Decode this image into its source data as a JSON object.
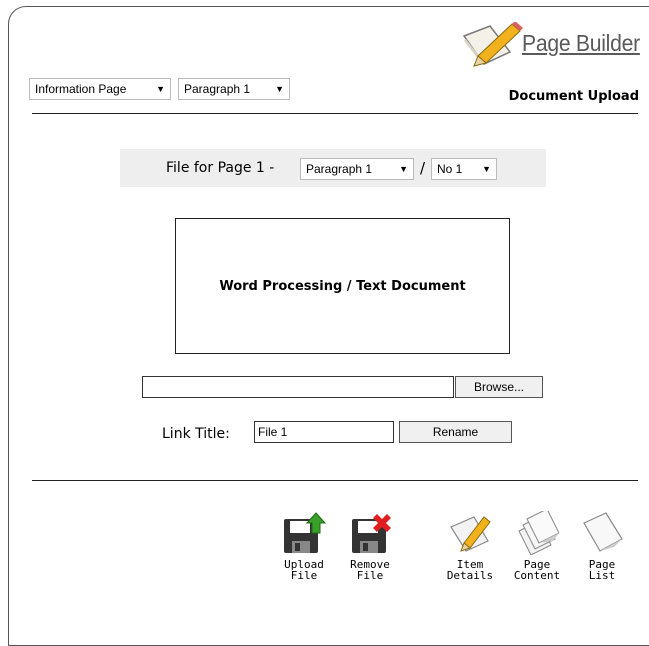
{
  "header": {
    "page_type": "Information Page",
    "paragraph": "Paragraph 1",
    "logo_text": "Page Builder",
    "subtitle": "Document Upload"
  },
  "file_bar": {
    "label": "File for Page 1 -",
    "paragraph": "Paragraph 1",
    "separator": "/",
    "number": "No 1"
  },
  "document": {
    "label": "Word Processing / Text Document"
  },
  "upload": {
    "path_value": "",
    "browse_label": "Browse..."
  },
  "link": {
    "label": "Link Title:",
    "value": "File 1",
    "rename_label": "Rename"
  },
  "toolbar": {
    "upload_line1": "Upload",
    "upload_line2": "File",
    "remove_line1": "Remove",
    "remove_line2": "File",
    "item_line1": "Item",
    "item_line2": "Details",
    "content_line1": "Page",
    "content_line2": "Content",
    "list_line1": "Page",
    "list_line2": "List"
  },
  "colors": {
    "frame": "#555555",
    "filebar_bg": "#eeeeee",
    "upload_arrow": "#3aa02a",
    "remove_x": "#e02020",
    "floppy": "#333333"
  },
  "icons": [
    "page-builder-logo-icon",
    "upload-file-icon",
    "remove-file-icon",
    "item-details-icon",
    "page-content-icon",
    "page-list-icon"
  ]
}
